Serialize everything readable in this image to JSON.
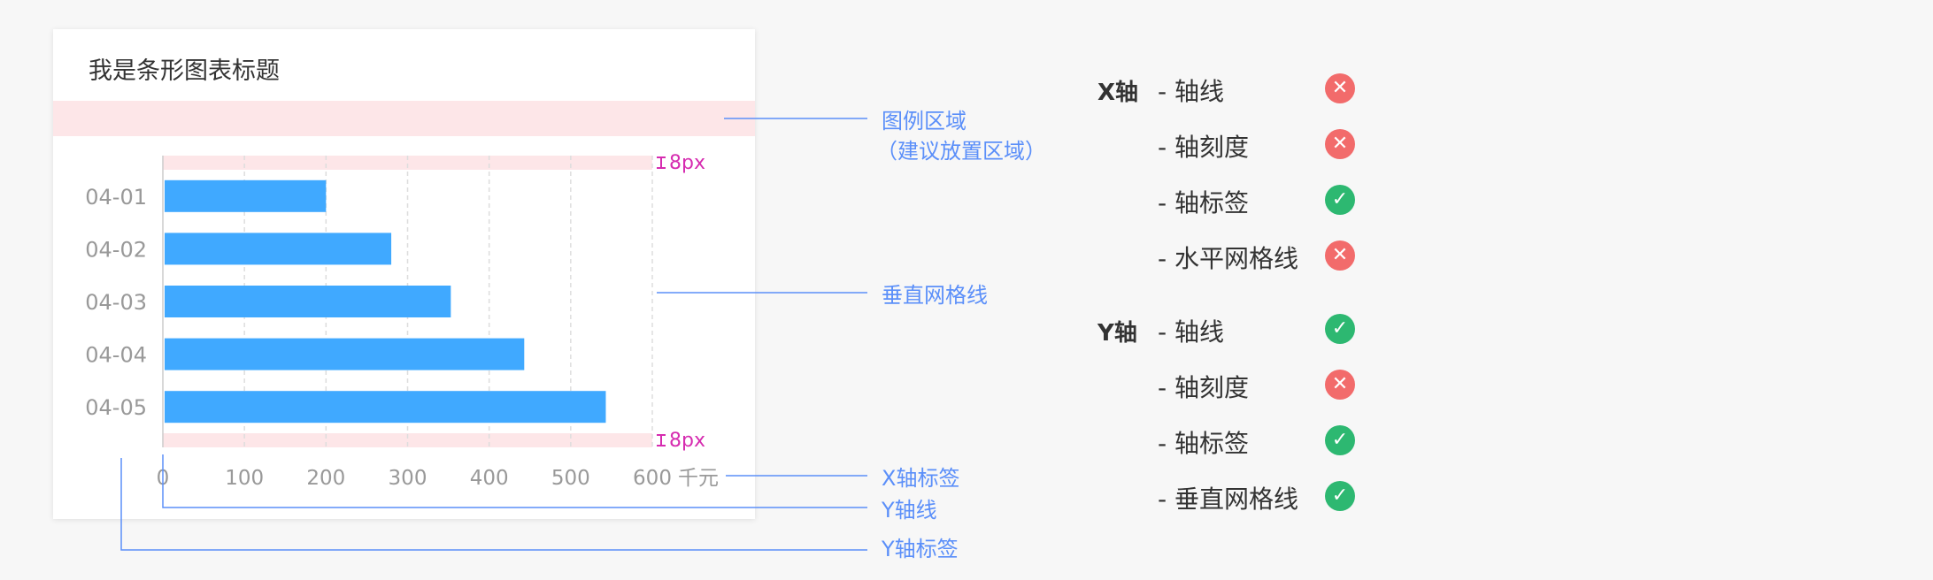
{
  "chart": {
    "title": "我是条形图表标题"
  },
  "chart_data": {
    "type": "bar",
    "orientation": "horizontal",
    "categories": [
      "04-01",
      "04-02",
      "04-03",
      "04-04",
      "04-05"
    ],
    "values": [
      200,
      280,
      353,
      443,
      543
    ],
    "x_ticks": [
      "0",
      "100",
      "200",
      "300",
      "400",
      "500",
      "600"
    ],
    "xlim": [
      0,
      600
    ],
    "unit": "千元",
    "padding_label": "8px",
    "colors": {
      "bar": "#40a9ff",
      "padding": "#fde6e8",
      "padding_label": "#d62cb0",
      "grid": "#dddddd",
      "tick_label": "#999999",
      "annotation": "#5b8ff9"
    }
  },
  "annotations": {
    "legend_area": "图例区域",
    "legend_area_note": "（建议放置区域）",
    "vertical_grid": "垂直网格线",
    "x_axis_label": "X轴标签",
    "y_axis_line": "Y轴线",
    "y_axis_label": "Y轴标签"
  },
  "spec": {
    "x_axis": {
      "name": "X轴",
      "items": [
        {
          "label": "- 轴线",
          "status": "no"
        },
        {
          "label": "- 轴刻度",
          "status": "no"
        },
        {
          "label": "- 轴标签",
          "status": "yes"
        },
        {
          "label": "- 水平网格线",
          "status": "no"
        }
      ]
    },
    "y_axis": {
      "name": "Y轴",
      "items": [
        {
          "label": "- 轴线",
          "status": "yes"
        },
        {
          "label": "- 轴刻度",
          "status": "no"
        },
        {
          "label": "- 轴标签",
          "status": "yes"
        },
        {
          "label": "- 垂直网格线",
          "status": "yes"
        }
      ]
    },
    "icons": {
      "yes": "check-icon",
      "no": "cross-icon"
    },
    "status_colors": {
      "yes": "#2db871",
      "no": "#f26b6b"
    }
  }
}
